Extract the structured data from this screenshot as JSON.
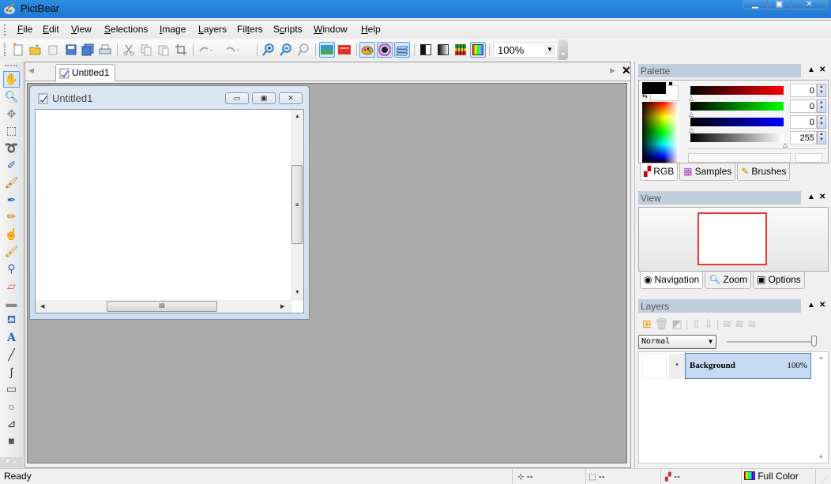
{
  "window": {
    "title": "PictBear",
    "minimize": "—",
    "maximize": "▢",
    "close": "X"
  },
  "menu": [
    {
      "label": "File",
      "accel": "F",
      "rest": "ile"
    },
    {
      "label": "Edit",
      "accel": "E",
      "rest": "dit"
    },
    {
      "label": "View",
      "accel": "V",
      "rest": "iew"
    },
    {
      "label": "Selections",
      "accel": "S",
      "rest": "elections"
    },
    {
      "label": "Image",
      "accel": "I",
      "rest": "mage"
    },
    {
      "label": "Layers",
      "accel": "L",
      "rest": "ayers"
    },
    {
      "label": "Filters",
      "pre": "Fil",
      "accel": "t",
      "rest": "ers"
    },
    {
      "label": "Scripts",
      "pre": "S",
      "accel": "c",
      "rest": "ripts"
    },
    {
      "label": "Window",
      "accel": "W",
      "rest": "indow"
    },
    {
      "label": "Help",
      "accel": "H",
      "rest": "elp"
    }
  ],
  "toolbar": {
    "buttons": [
      "new-icon",
      "open-icon",
      "paste-new-icon",
      "save-icon",
      "save-all-icon",
      "print-icon",
      "cut-icon",
      "copy-icon",
      "paste-icon",
      "crop-icon",
      "undo-icon",
      "redo-icon",
      "zoom-in-icon",
      "zoom-out-icon",
      "zoom-actual-icon",
      "view-image-icon",
      "view-background-icon",
      "palette-toggle-icon",
      "navigator-toggle-icon",
      "layers-toggle-icon",
      "grayscale-icon",
      "gradient-icon",
      "levels-icon",
      "fullcolor-icon"
    ],
    "zoom_value": "100%"
  },
  "tools": [
    "hand",
    "zoom",
    "move",
    "rect-select",
    "lasso",
    "color-pen",
    "brush",
    "airbrush",
    "pencil",
    "smudge",
    "dodge",
    "eyedropper",
    "eraser",
    "gradient",
    "fill",
    "text",
    "line",
    "curve",
    "rectangle",
    "ellipse",
    "polygon",
    "gradient-rect"
  ],
  "document": {
    "tab_label": "Untitled1",
    "window_title": "Untitled1"
  },
  "palette": {
    "title": "Palette",
    "channels": [
      {
        "name": "red",
        "value": "0",
        "color": "#ff0000"
      },
      {
        "name": "green",
        "value": "0",
        "color": "#00ff00"
      },
      {
        "name": "blue",
        "value": "0",
        "color": "#0000ff"
      },
      {
        "name": "alpha",
        "value": "255",
        "color": "#ffffff"
      }
    ],
    "foreground": "#000000",
    "background": "#ffffff",
    "tabs": [
      "RGB",
      "Samples",
      "Brushes"
    ]
  },
  "view_panel": {
    "title": "View",
    "tabs": [
      "Navigation",
      "Zoom",
      "Options"
    ],
    "frame_color": "#ee3333"
  },
  "layers_panel": {
    "title": "Layers",
    "blend_mode": "Normal",
    "opacity_pct": 100,
    "layers": [
      {
        "name": "Background",
        "opacity": "100%",
        "marker": "*"
      }
    ]
  },
  "status": {
    "ready": "Ready",
    "position": "--",
    "size": "--",
    "color": "--",
    "mode": "Full Color"
  }
}
